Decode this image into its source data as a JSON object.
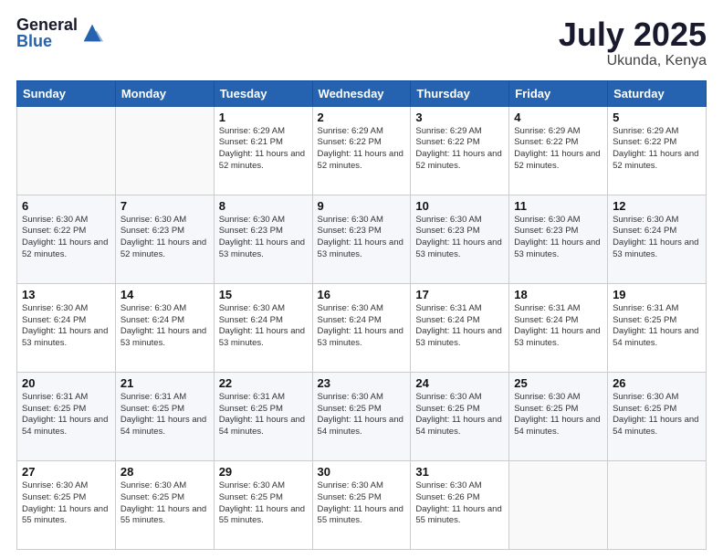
{
  "logo": {
    "general": "General",
    "blue": "Blue"
  },
  "header": {
    "month": "July 2025",
    "location": "Ukunda, Kenya"
  },
  "weekdays": [
    "Sunday",
    "Monday",
    "Tuesday",
    "Wednesday",
    "Thursday",
    "Friday",
    "Saturday"
  ],
  "weeks": [
    [
      {
        "day": "",
        "sunrise": "",
        "sunset": "",
        "daylight": ""
      },
      {
        "day": "",
        "sunrise": "",
        "sunset": "",
        "daylight": ""
      },
      {
        "day": "1",
        "sunrise": "Sunrise: 6:29 AM",
        "sunset": "Sunset: 6:21 PM",
        "daylight": "Daylight: 11 hours and 52 minutes."
      },
      {
        "day": "2",
        "sunrise": "Sunrise: 6:29 AM",
        "sunset": "Sunset: 6:22 PM",
        "daylight": "Daylight: 11 hours and 52 minutes."
      },
      {
        "day": "3",
        "sunrise": "Sunrise: 6:29 AM",
        "sunset": "Sunset: 6:22 PM",
        "daylight": "Daylight: 11 hours and 52 minutes."
      },
      {
        "day": "4",
        "sunrise": "Sunrise: 6:29 AM",
        "sunset": "Sunset: 6:22 PM",
        "daylight": "Daylight: 11 hours and 52 minutes."
      },
      {
        "day": "5",
        "sunrise": "Sunrise: 6:29 AM",
        "sunset": "Sunset: 6:22 PM",
        "daylight": "Daylight: 11 hours and 52 minutes."
      }
    ],
    [
      {
        "day": "6",
        "sunrise": "Sunrise: 6:30 AM",
        "sunset": "Sunset: 6:22 PM",
        "daylight": "Daylight: 11 hours and 52 minutes."
      },
      {
        "day": "7",
        "sunrise": "Sunrise: 6:30 AM",
        "sunset": "Sunset: 6:23 PM",
        "daylight": "Daylight: 11 hours and 52 minutes."
      },
      {
        "day": "8",
        "sunrise": "Sunrise: 6:30 AM",
        "sunset": "Sunset: 6:23 PM",
        "daylight": "Daylight: 11 hours and 53 minutes."
      },
      {
        "day": "9",
        "sunrise": "Sunrise: 6:30 AM",
        "sunset": "Sunset: 6:23 PM",
        "daylight": "Daylight: 11 hours and 53 minutes."
      },
      {
        "day": "10",
        "sunrise": "Sunrise: 6:30 AM",
        "sunset": "Sunset: 6:23 PM",
        "daylight": "Daylight: 11 hours and 53 minutes."
      },
      {
        "day": "11",
        "sunrise": "Sunrise: 6:30 AM",
        "sunset": "Sunset: 6:23 PM",
        "daylight": "Daylight: 11 hours and 53 minutes."
      },
      {
        "day": "12",
        "sunrise": "Sunrise: 6:30 AM",
        "sunset": "Sunset: 6:24 PM",
        "daylight": "Daylight: 11 hours and 53 minutes."
      }
    ],
    [
      {
        "day": "13",
        "sunrise": "Sunrise: 6:30 AM",
        "sunset": "Sunset: 6:24 PM",
        "daylight": "Daylight: 11 hours and 53 minutes."
      },
      {
        "day": "14",
        "sunrise": "Sunrise: 6:30 AM",
        "sunset": "Sunset: 6:24 PM",
        "daylight": "Daylight: 11 hours and 53 minutes."
      },
      {
        "day": "15",
        "sunrise": "Sunrise: 6:30 AM",
        "sunset": "Sunset: 6:24 PM",
        "daylight": "Daylight: 11 hours and 53 minutes."
      },
      {
        "day": "16",
        "sunrise": "Sunrise: 6:30 AM",
        "sunset": "Sunset: 6:24 PM",
        "daylight": "Daylight: 11 hours and 53 minutes."
      },
      {
        "day": "17",
        "sunrise": "Sunrise: 6:31 AM",
        "sunset": "Sunset: 6:24 PM",
        "daylight": "Daylight: 11 hours and 53 minutes."
      },
      {
        "day": "18",
        "sunrise": "Sunrise: 6:31 AM",
        "sunset": "Sunset: 6:24 PM",
        "daylight": "Daylight: 11 hours and 53 minutes."
      },
      {
        "day": "19",
        "sunrise": "Sunrise: 6:31 AM",
        "sunset": "Sunset: 6:25 PM",
        "daylight": "Daylight: 11 hours and 54 minutes."
      }
    ],
    [
      {
        "day": "20",
        "sunrise": "Sunrise: 6:31 AM",
        "sunset": "Sunset: 6:25 PM",
        "daylight": "Daylight: 11 hours and 54 minutes."
      },
      {
        "day": "21",
        "sunrise": "Sunrise: 6:31 AM",
        "sunset": "Sunset: 6:25 PM",
        "daylight": "Daylight: 11 hours and 54 minutes."
      },
      {
        "day": "22",
        "sunrise": "Sunrise: 6:31 AM",
        "sunset": "Sunset: 6:25 PM",
        "daylight": "Daylight: 11 hours and 54 minutes."
      },
      {
        "day": "23",
        "sunrise": "Sunrise: 6:30 AM",
        "sunset": "Sunset: 6:25 PM",
        "daylight": "Daylight: 11 hours and 54 minutes."
      },
      {
        "day": "24",
        "sunrise": "Sunrise: 6:30 AM",
        "sunset": "Sunset: 6:25 PM",
        "daylight": "Daylight: 11 hours and 54 minutes."
      },
      {
        "day": "25",
        "sunrise": "Sunrise: 6:30 AM",
        "sunset": "Sunset: 6:25 PM",
        "daylight": "Daylight: 11 hours and 54 minutes."
      },
      {
        "day": "26",
        "sunrise": "Sunrise: 6:30 AM",
        "sunset": "Sunset: 6:25 PM",
        "daylight": "Daylight: 11 hours and 54 minutes."
      }
    ],
    [
      {
        "day": "27",
        "sunrise": "Sunrise: 6:30 AM",
        "sunset": "Sunset: 6:25 PM",
        "daylight": "Daylight: 11 hours and 55 minutes."
      },
      {
        "day": "28",
        "sunrise": "Sunrise: 6:30 AM",
        "sunset": "Sunset: 6:25 PM",
        "daylight": "Daylight: 11 hours and 55 minutes."
      },
      {
        "day": "29",
        "sunrise": "Sunrise: 6:30 AM",
        "sunset": "Sunset: 6:25 PM",
        "daylight": "Daylight: 11 hours and 55 minutes."
      },
      {
        "day": "30",
        "sunrise": "Sunrise: 6:30 AM",
        "sunset": "Sunset: 6:25 PM",
        "daylight": "Daylight: 11 hours and 55 minutes."
      },
      {
        "day": "31",
        "sunrise": "Sunrise: 6:30 AM",
        "sunset": "Sunset: 6:26 PM",
        "daylight": "Daylight: 11 hours and 55 minutes."
      },
      {
        "day": "",
        "sunrise": "",
        "sunset": "",
        "daylight": ""
      },
      {
        "day": "",
        "sunrise": "",
        "sunset": "",
        "daylight": ""
      }
    ]
  ]
}
